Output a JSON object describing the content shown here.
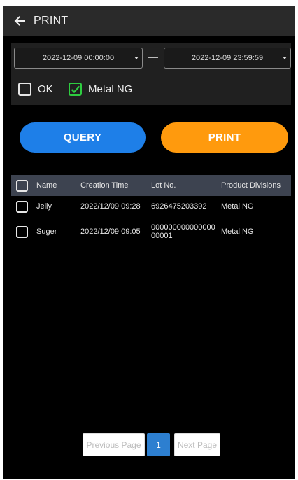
{
  "header": {
    "title": "PRINT",
    "back_icon": "arrow-left-icon"
  },
  "filter": {
    "start_datetime": "2022-12-09 00:00:00",
    "end_datetime": "2022-12-09 23:59:59",
    "checkboxes": [
      {
        "label": "OK",
        "checked": false
      },
      {
        "label": "Metal NG",
        "checked": true
      }
    ]
  },
  "actions": {
    "query_label": "QUERY",
    "print_label": "PRINT"
  },
  "table": {
    "columns": [
      "Name",
      "Creation Time",
      "Lot No.",
      "Product Divisions"
    ],
    "rows": [
      {
        "name": "Jelly",
        "creation_time": "2022/12/09 09:28",
        "lot_no_1": "6926475203392",
        "lot_no_2": "",
        "division": "Metal NG"
      },
      {
        "name": "Suger",
        "creation_time": "2022/12/09 09:05",
        "lot_no_1": "000000000000000",
        "lot_no_2": "00001",
        "division": "Metal NG"
      }
    ]
  },
  "pagination": {
    "prev_label": "Previous Page",
    "current_page": "1",
    "next_label": "Next Page"
  },
  "colors": {
    "query": "#1e7fe8",
    "print": "#ff9a0d",
    "checked": "#2ecc40",
    "header_row": "#3d4350",
    "current_page": "#2d7fd0"
  }
}
